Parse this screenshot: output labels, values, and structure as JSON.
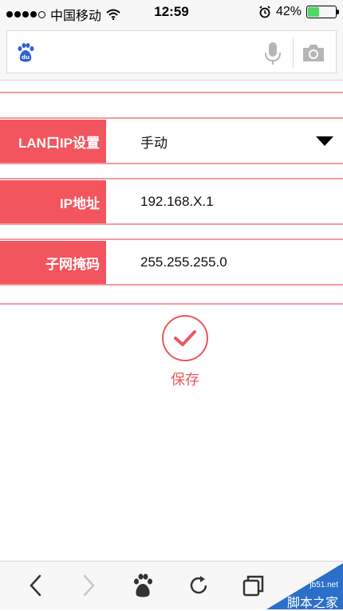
{
  "status_bar": {
    "carrier": "中国移动",
    "time": "12:59",
    "battery_percent": "42%",
    "battery_level": 0.42,
    "icons": [
      "signal-dots-icon",
      "wifi-icon",
      "alarm-icon",
      "battery-icon"
    ]
  },
  "search_bar": {
    "icons": [
      "baidu-logo-icon",
      "microphone-icon",
      "camera-icon"
    ]
  },
  "form": {
    "rows": [
      {
        "label": "LAN口IP设置",
        "value": "手动"
      },
      {
        "label": "IP地址",
        "value": "192.168.X.1"
      },
      {
        "label": "子网掩码",
        "value": "255.255.255.0"
      }
    ]
  },
  "save": {
    "label": "保存"
  },
  "toolbar": {
    "icons": [
      "back-icon",
      "forward-icon",
      "baidu-paw-icon",
      "refresh-icon",
      "tabs-icon"
    ]
  },
  "watermark": {
    "url": "jb51.net",
    "name": "脚本之家"
  },
  "colors": {
    "accent": "#f3555e",
    "rule": "#f39aa0",
    "save": "#e9585f",
    "battery": "#4cd964"
  }
}
